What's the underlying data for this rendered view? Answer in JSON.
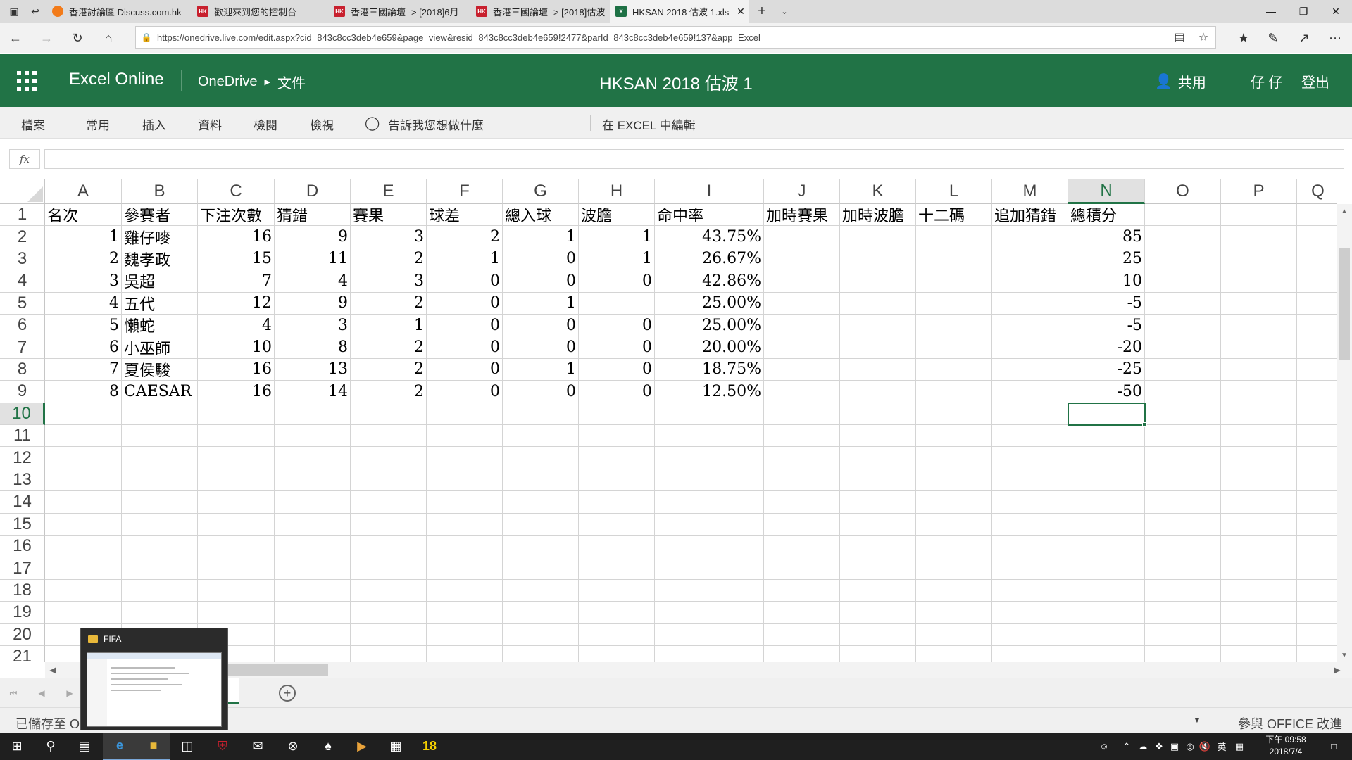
{
  "browser": {
    "tabs": [
      {
        "title": "香港討論區 Discuss.com.hk",
        "favicon": "orange-circle"
      },
      {
        "title": "歡迎來到您的控制台",
        "favicon": "HK"
      },
      {
        "title": "香港三國論壇 -> [2018]6月",
        "favicon": "HK"
      },
      {
        "title": "香港三國論壇 -> [2018]估波",
        "favicon": "HK"
      },
      {
        "title": "HKSAN 2018 估波 1.xls",
        "favicon": "excel"
      }
    ],
    "url": "https://onedrive.live.com/edit.aspx?cid=843c8cc3deb4e659&page=view&resid=843c8cc3deb4e659!2477&parId=843c8cc3deb4e659!137&app=Excel"
  },
  "header": {
    "app_name": "Excel Online",
    "breadcrumb_root": "OneDrive",
    "breadcrumb_folder": "文件",
    "doc_title": "HKSAN 2018 估波 1",
    "share_label": "共用",
    "user_name": "仔 仔",
    "signout_label": "登出"
  },
  "ribbon": {
    "file": "檔案",
    "home": "常用",
    "insert": "插入",
    "data": "資料",
    "review": "檢閱",
    "view": "檢視",
    "tell_me": "告訴我您想做什麼",
    "edit_in_excel": "在 EXCEL 中編輯"
  },
  "formula_bar": {
    "fx": "fx",
    "value": ""
  },
  "grid": {
    "columns": [
      "A",
      "B",
      "C",
      "D",
      "E",
      "F",
      "G",
      "H",
      "I",
      "J",
      "K",
      "L",
      "M",
      "N",
      "O",
      "P",
      "Q"
    ],
    "rows": [
      "1",
      "2",
      "3",
      "4",
      "5",
      "6",
      "7",
      "8",
      "9",
      "10",
      "11",
      "12",
      "13",
      "14",
      "15",
      "16",
      "17",
      "18",
      "19",
      "20",
      "21"
    ],
    "header_row": [
      "名次",
      "參賽者",
      "下注次數",
      "猜錯",
      "賽果",
      "球差",
      "總入球",
      "波膽",
      "命中率",
      "加時賽果",
      "加時波膽",
      "十二碼",
      "追加猜錯",
      "總積分"
    ],
    "data_rows": [
      [
        "1",
        "雞仔嘜",
        "16",
        "9",
        "3",
        "2",
        "1",
        "1",
        "43.75%",
        "",
        "",
        "",
        "",
        "85"
      ],
      [
        "2",
        "魏孝政",
        "15",
        "11",
        "2",
        "1",
        "0",
        "1",
        "26.67%",
        "",
        "",
        "",
        "",
        "25"
      ],
      [
        "3",
        "吳超",
        "7",
        "4",
        "3",
        "0",
        "0",
        "0",
        "42.86%",
        "",
        "",
        "",
        "",
        "10"
      ],
      [
        "4",
        "五代",
        "12",
        "9",
        "2",
        "0",
        "1",
        "",
        "25.00%",
        "",
        "",
        "",
        "",
        "-5"
      ],
      [
        "5",
        "懶蛇",
        "4",
        "3",
        "1",
        "0",
        "0",
        "0",
        "25.00%",
        "",
        "",
        "",
        "",
        "-5"
      ],
      [
        "6",
        "小巫師",
        "10",
        "8",
        "2",
        "0",
        "0",
        "0",
        "20.00%",
        "",
        "",
        "",
        "",
        "-20"
      ],
      [
        "7",
        "夏侯駿",
        "16",
        "13",
        "2",
        "0",
        "1",
        "0",
        "18.75%",
        "",
        "",
        "",
        "",
        "-25"
      ],
      [
        "8",
        "CAESAR",
        "16",
        "14",
        "2",
        "0",
        "0",
        "0",
        "12.50%",
        "",
        "",
        "",
        "",
        "-50"
      ]
    ],
    "selected_cell": "N10"
  },
  "status": {
    "saved": "已儲存至 O",
    "improve": "參與 OFFICE 改進"
  },
  "thumbnail_popup": {
    "title": "FIFA"
  },
  "taskbar": {
    "badge_number": "18",
    "clock_time": "下午 09:58",
    "clock_date": "2018/7/4",
    "ime": "英"
  },
  "colors": {
    "excel_green": "#217346",
    "taskbar": "#1f1f1f"
  }
}
